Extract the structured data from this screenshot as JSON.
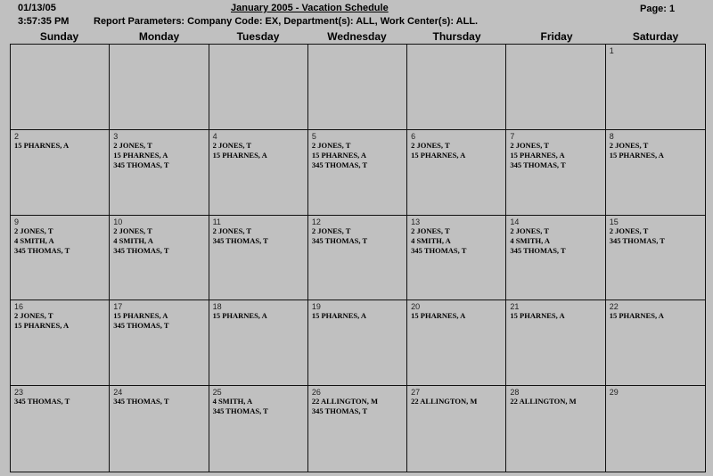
{
  "header": {
    "date": "01/13/05",
    "time": "3:57:35 PM",
    "title": "January 2005 - Vacation Schedule",
    "page": "Page: 1",
    "parameters": "Report Parameters:  Company Code:  EX,  Department(s):  ALL,  Work Center(s):  ALL."
  },
  "days_of_week": [
    "Sunday",
    "Monday",
    "Tuesday",
    "Wednesday",
    "Thursday",
    "Friday",
    "Saturday"
  ],
  "weeks": [
    [
      {
        "day": "",
        "entries": []
      },
      {
        "day": "",
        "entries": []
      },
      {
        "day": "",
        "entries": []
      },
      {
        "day": "",
        "entries": []
      },
      {
        "day": "",
        "entries": []
      },
      {
        "day": "",
        "entries": []
      },
      {
        "day": "1",
        "entries": []
      }
    ],
    [
      {
        "day": "2",
        "entries": [
          "15 PHARNES, A"
        ]
      },
      {
        "day": "3",
        "entries": [
          "2 JONES, T",
          "15 PHARNES, A",
          "345 THOMAS, T"
        ]
      },
      {
        "day": "4",
        "entries": [
          "2 JONES, T",
          "15 PHARNES, A"
        ]
      },
      {
        "day": "5",
        "entries": [
          "2 JONES, T",
          "15 PHARNES, A",
          "345 THOMAS, T"
        ]
      },
      {
        "day": "6",
        "entries": [
          "2 JONES, T",
          "15 PHARNES, A"
        ]
      },
      {
        "day": "7",
        "entries": [
          "2 JONES, T",
          "15 PHARNES, A",
          "345 THOMAS, T"
        ]
      },
      {
        "day": "8",
        "entries": [
          "2 JONES, T",
          "15 PHARNES, A"
        ]
      }
    ],
    [
      {
        "day": "9",
        "entries": [
          "2 JONES, T",
          "4 SMITH, A",
          "345 THOMAS, T"
        ]
      },
      {
        "day": "10",
        "entries": [
          "2 JONES, T",
          "4 SMITH, A",
          "345 THOMAS, T"
        ]
      },
      {
        "day": "11",
        "entries": [
          "2 JONES, T",
          "345 THOMAS, T"
        ]
      },
      {
        "day": "12",
        "entries": [
          "2 JONES, T",
          "345 THOMAS, T"
        ]
      },
      {
        "day": "13",
        "entries": [
          "2 JONES, T",
          "4 SMITH, A",
          "345 THOMAS, T"
        ]
      },
      {
        "day": "14",
        "entries": [
          "2 JONES, T",
          "4 SMITH, A",
          "345 THOMAS, T"
        ]
      },
      {
        "day": "15",
        "entries": [
          "2 JONES, T",
          "345 THOMAS, T"
        ]
      }
    ],
    [
      {
        "day": "16",
        "entries": [
          "2 JONES, T",
          "15 PHARNES, A"
        ]
      },
      {
        "day": "17",
        "entries": [
          "15 PHARNES, A",
          "345 THOMAS, T"
        ]
      },
      {
        "day": "18",
        "entries": [
          "15 PHARNES, A"
        ]
      },
      {
        "day": "19",
        "entries": [
          "15 PHARNES, A"
        ]
      },
      {
        "day": "20",
        "entries": [
          "15 PHARNES, A"
        ]
      },
      {
        "day": "21",
        "entries": [
          "15 PHARNES, A"
        ]
      },
      {
        "day": "22",
        "entries": [
          "15 PHARNES, A"
        ]
      }
    ],
    [
      {
        "day": "23",
        "entries": [
          "345 THOMAS, T"
        ]
      },
      {
        "day": "24",
        "entries": [
          "345 THOMAS, T"
        ]
      },
      {
        "day": "25",
        "entries": [
          "4 SMITH, A",
          "345 THOMAS, T"
        ]
      },
      {
        "day": "26",
        "entries": [
          "22 ALLINGTON, M",
          "345 THOMAS, T"
        ]
      },
      {
        "day": "27",
        "entries": [
          "22 ALLINGTON, M"
        ]
      },
      {
        "day": "28",
        "entries": [
          "22 ALLINGTON, M"
        ]
      },
      {
        "day": "29",
        "entries": []
      }
    ]
  ]
}
